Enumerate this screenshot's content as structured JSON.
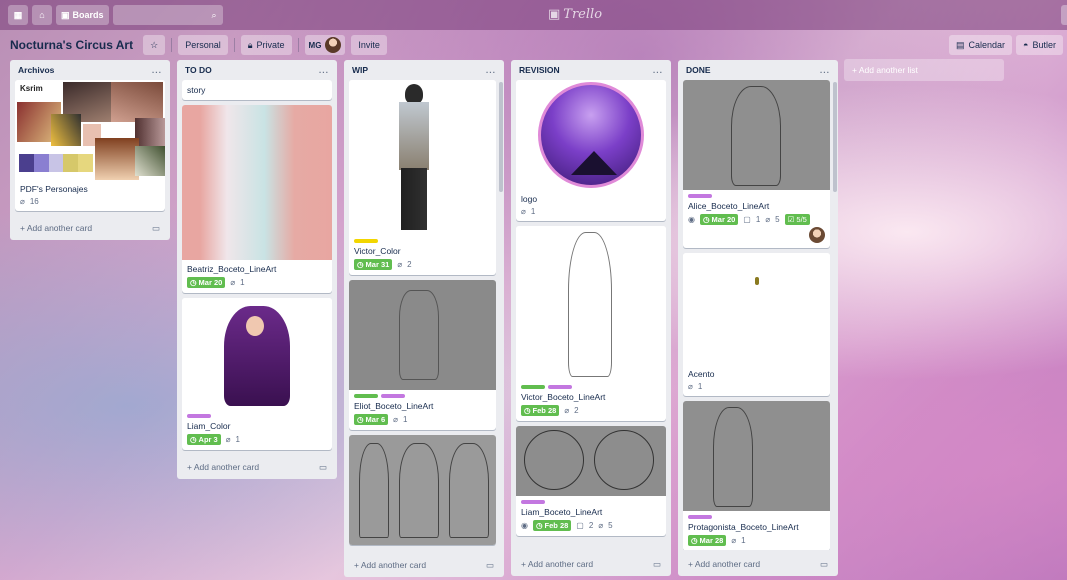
{
  "topbar": {
    "boards_label": "Boards",
    "logo_text": "Trello"
  },
  "board": {
    "title": "Nocturna's Circus Art",
    "team": "Personal",
    "visibility": "Private",
    "member_initials": "MG",
    "invite": "Invite",
    "calendar": "Calendar",
    "butler": "Butler"
  },
  "add_another_card": "Add another card",
  "add_another_list": "+ Add another list",
  "lists": {
    "archivos": {
      "title": "Archivos",
      "menu": "...",
      "card1": {
        "title": "PDF's Personajes",
        "attachments": "16",
        "cover_text": "Ksrim"
      }
    },
    "todo": {
      "title": "TO DO",
      "menu": "...",
      "card1": {
        "title": "story"
      },
      "card2": {
        "title": "Beatriz_Boceto_LineArt",
        "due": "Mar 20",
        "attachments": "1"
      },
      "card3": {
        "title": "Liam_Color",
        "due": "Apr 3",
        "attachments": "1"
      }
    },
    "wip": {
      "title": "WIP",
      "menu": "...",
      "card1": {
        "title": "Victor_Color",
        "due": "Mar 31",
        "attachments": "2"
      },
      "card2": {
        "title": "Eliot_Boceto_LineArt",
        "due": "Mar 6",
        "attachments": "1"
      }
    },
    "revision": {
      "title": "REVISION",
      "menu": "...",
      "card1": {
        "title": "logo",
        "attachments": "1"
      },
      "card2": {
        "title": "Victor_Boceto_LineArt",
        "due": "Feb 28",
        "attachments": "2"
      },
      "card3": {
        "title": "Liam_Boceto_LineArt",
        "due": "Feb 28",
        "comments": "2",
        "attachments": "5"
      }
    },
    "done": {
      "title": "DONE",
      "menu": "...",
      "card1": {
        "title": "Alice_Boceto_LineArt",
        "due": "Mar 20",
        "comments": "1",
        "attachments": "5",
        "checklist": "5/5"
      },
      "card2": {
        "title": "Acento",
        "attachments": "1"
      },
      "card3": {
        "title": "Protagonista_Boceto_LineArt",
        "due": "Mar 28",
        "attachments": "1"
      }
    }
  },
  "colors": {
    "label_purple": "#c377e0",
    "label_green": "#61bd4f",
    "label_yellow": "#f2d600",
    "due_green": "#61bd4f"
  }
}
